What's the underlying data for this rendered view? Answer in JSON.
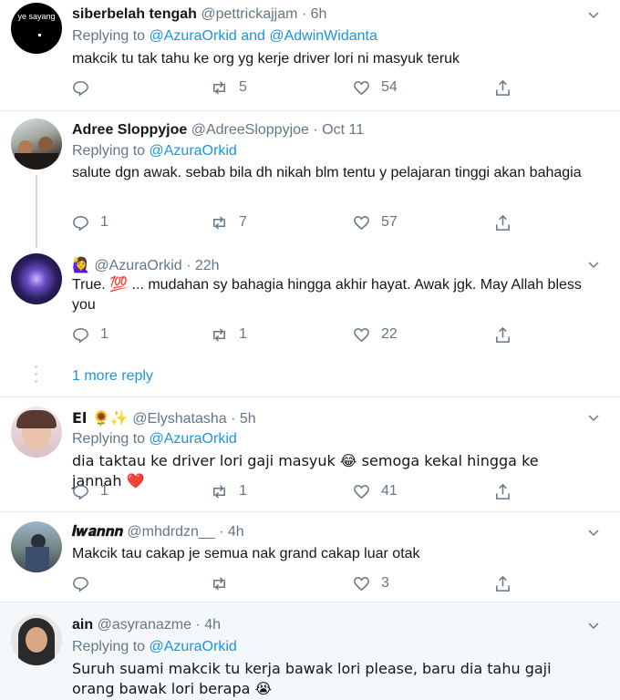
{
  "tweets": [
    {
      "avatar_text": "ye sayang",
      "name": "siberbelah tengah",
      "handle": "@pettrickajjam",
      "time": "6h",
      "replying_prefix": "Replying to ",
      "replying_to": "@AzuraOrkid and @AdwinWidanta",
      "text": "makcik tu tak tahu ke org yg kerje driver lori ni masyuk teruk",
      "replies": "",
      "retweets": "5",
      "likes": "54"
    },
    {
      "name": "Adree Sloppyjoe",
      "handle": "@AdreeSloppyjoe",
      "time": "Oct 11",
      "replying_prefix": "Replying to ",
      "replying_to": "@AzuraOrkid",
      "text": "salute dgn awak. sebab bila dh nikah blm tentu y pelajaran tinggi akan bahagia",
      "replies": "1",
      "retweets": "7",
      "likes": "57"
    },
    {
      "name_emoji": "🙋‍♀️",
      "handle": "@AzuraOrkid",
      "time": "22h",
      "text": "True. 💯 ... mudahan sy bahagia hingga akhir hayat. Awak jgk. May Allah bless you",
      "replies": "1",
      "retweets": "1",
      "likes": "22"
    },
    {
      "name": "El 🌻✨",
      "handle": "@Elyshatasha",
      "time": "5h",
      "replying_prefix": "Replying to ",
      "replying_to": "@AzuraOrkid",
      "text": "dia taktau ke driver lori gaji masyuk 😂  semoga kekal hingga ke jannah ❤️",
      "replies": "1",
      "retweets": "1",
      "likes": "41"
    },
    {
      "name": "𝑰𝒘𝒂𝒏𝒏𝒏",
      "handle": "@mhdrdzn__",
      "time": "4h",
      "text": "Makcik tau cakap je semua nak grand cakap luar otak",
      "replies": "",
      "retweets": "",
      "likes": "3"
    },
    {
      "name": "ain",
      "handle": "@asyranazme",
      "time": "4h",
      "replying_prefix": "Replying to ",
      "replying_to": "@AzuraOrkid",
      "text": "Suruh suami makcik tu kerja bawak lori please, baru dia tahu gaji orang bawak lori berapa 😭"
    }
  ],
  "more_replies": "1 more reply",
  "separator": " · ",
  "colors": {
    "link": "#1b95e0",
    "meta": "#657786",
    "heart": "#e0245e"
  }
}
